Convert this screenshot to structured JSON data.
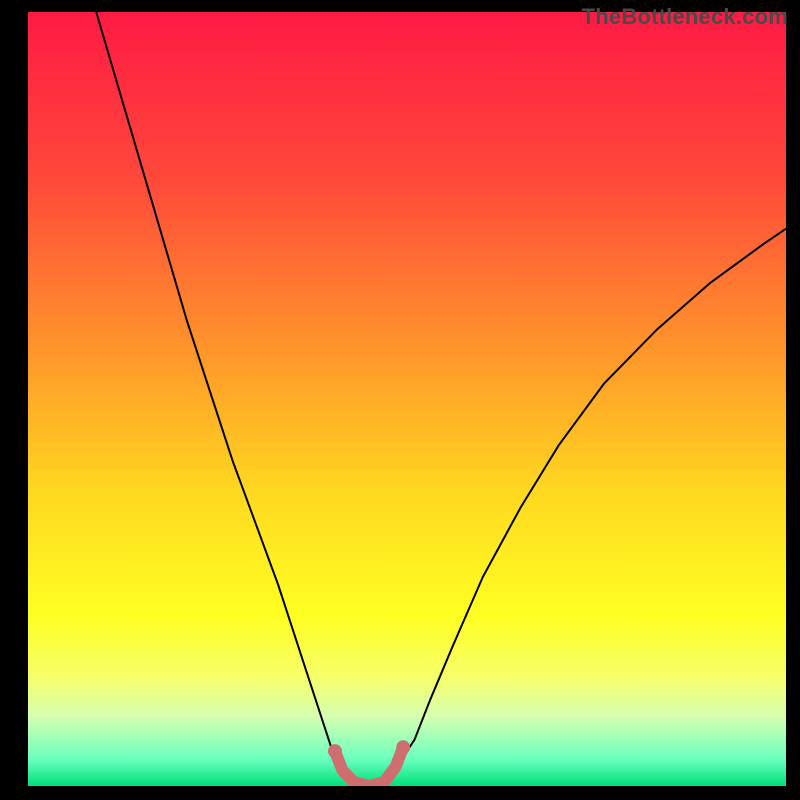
{
  "watermark": "TheBottleneck.com",
  "chart_data": {
    "type": "line",
    "title": "",
    "xlabel": "",
    "ylabel": "",
    "xlim": [
      0,
      100
    ],
    "ylim": [
      0,
      100
    ],
    "axes_visible": false,
    "legend": false,
    "background_gradient": {
      "type": "vertical",
      "stops": [
        {
          "pos": 0.0,
          "color": "#ff1a44"
        },
        {
          "pos": 0.22,
          "color": "#ff4a3a"
        },
        {
          "pos": 0.45,
          "color": "#ff9a2a"
        },
        {
          "pos": 0.62,
          "color": "#ffd820"
        },
        {
          "pos": 0.78,
          "color": "#ffff22"
        },
        {
          "pos": 0.86,
          "color": "#f6ff6a"
        },
        {
          "pos": 0.91,
          "color": "#d6ffb0"
        },
        {
          "pos": 0.965,
          "color": "#6bffbe"
        },
        {
          "pos": 1.0,
          "color": "#00e07a"
        }
      ]
    },
    "series": [
      {
        "name": "curve",
        "color": "#000000",
        "stroke_width": 2,
        "x": [
          9,
          12,
          15,
          18,
          21,
          24,
          27,
          30,
          33,
          35,
          37,
          39,
          40,
          41,
          42.5,
          45,
          47.5,
          49,
          51,
          53,
          56,
          60,
          65,
          70,
          76,
          83,
          90,
          97,
          100
        ],
        "y": [
          100,
          90,
          80,
          70,
          60,
          51,
          42,
          34,
          26,
          20,
          14,
          8,
          5,
          3,
          1,
          0,
          1,
          3,
          6,
          11,
          18,
          27,
          36,
          44,
          52,
          59,
          65,
          70,
          72
        ]
      },
      {
        "name": "highlight",
        "color": "#cf6e6e",
        "stroke_width": 12,
        "linecap": "round",
        "x": [
          40.5,
          41.5,
          43,
          45,
          47,
          48.5,
          49.5
        ],
        "y": [
          4.5,
          2,
          0.5,
          0,
          0.5,
          2.5,
          5
        ]
      }
    ],
    "markers": [
      {
        "x": 40.5,
        "y": 4.5,
        "r": 7,
        "color": "#cf6e6e"
      },
      {
        "x": 49.5,
        "y": 5.0,
        "r": 7,
        "color": "#cf6e6e"
      }
    ]
  }
}
